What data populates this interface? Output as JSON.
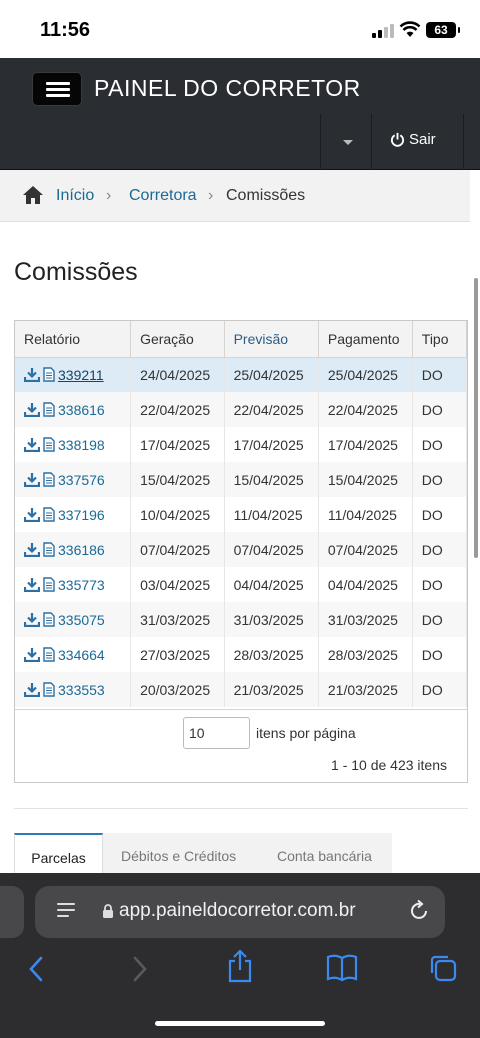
{
  "status": {
    "time": "11:56",
    "battery": "63"
  },
  "navbar": {
    "brand": "PAINEL DO CORRETOR",
    "logout_label": "Sair"
  },
  "breadcrumb": {
    "home": "Início",
    "middle": "Corretora",
    "current": "Comissões"
  },
  "page_title": "Comissões",
  "table": {
    "headers": [
      "Relatório",
      "Geração",
      "Previsão",
      "Pagamento",
      "Tipo"
    ],
    "rows": [
      {
        "report": "339211",
        "geracao": "24/04/2025",
        "previsao": "25/04/2025",
        "pagamento": "25/04/2025",
        "tipo": "DO"
      },
      {
        "report": "338616",
        "geracao": "22/04/2025",
        "previsao": "22/04/2025",
        "pagamento": "22/04/2025",
        "tipo": "DO"
      },
      {
        "report": "338198",
        "geracao": "17/04/2025",
        "previsao": "17/04/2025",
        "pagamento": "17/04/2025",
        "tipo": "DO"
      },
      {
        "report": "337576",
        "geracao": "15/04/2025",
        "previsao": "15/04/2025",
        "pagamento": "15/04/2025",
        "tipo": "DO"
      },
      {
        "report": "337196",
        "geracao": "10/04/2025",
        "previsao": "11/04/2025",
        "pagamento": "11/04/2025",
        "tipo": "DO"
      },
      {
        "report": "336186",
        "geracao": "07/04/2025",
        "previsao": "07/04/2025",
        "pagamento": "07/04/2025",
        "tipo": "DO"
      },
      {
        "report": "335773",
        "geracao": "03/04/2025",
        "previsao": "04/04/2025",
        "pagamento": "04/04/2025",
        "tipo": "DO"
      },
      {
        "report": "335075",
        "geracao": "31/03/2025",
        "previsao": "31/03/2025",
        "pagamento": "31/03/2025",
        "tipo": "DO"
      },
      {
        "report": "334664",
        "geracao": "27/03/2025",
        "previsao": "28/03/2025",
        "pagamento": "28/03/2025",
        "tipo": "DO"
      },
      {
        "report": "333553",
        "geracao": "20/03/2025",
        "previsao": "21/03/2025",
        "pagamento": "21/03/2025",
        "tipo": "DO"
      }
    ]
  },
  "pager": {
    "page_size": "10",
    "page_size_label": "itens por página",
    "count": "1 - 10 de 423 itens"
  },
  "tabs": [
    "Parcelas",
    "Débitos e Créditos",
    "Conta bancária"
  ],
  "safari": {
    "url": "app.paineldocorretor.com.br"
  },
  "colors": {
    "navbar": "#2a2e33",
    "link": "#1b6a96",
    "selected_row": "#dcebf5",
    "tab_accent": "#2b7bb9"
  }
}
